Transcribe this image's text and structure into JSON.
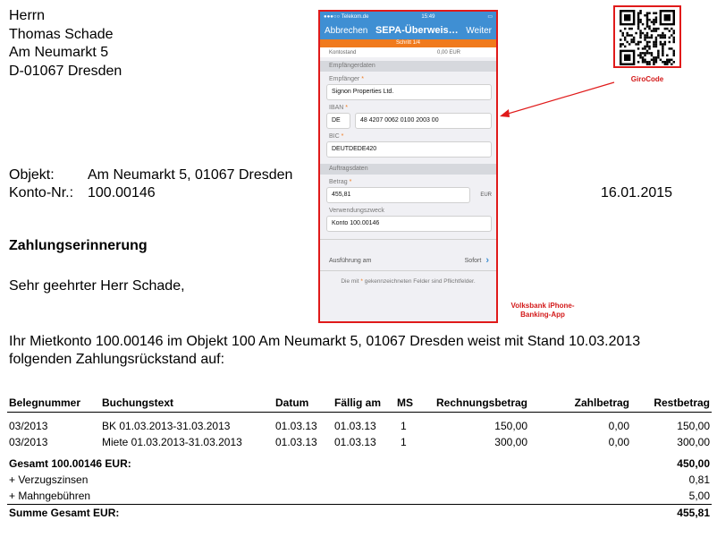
{
  "address": {
    "salutation": "Herrn",
    "name": "Thomas Schade",
    "street": "Am Neumarkt 5",
    "city": "D-01067 Dresden"
  },
  "meta": {
    "object_label": "Objekt:",
    "object_value": "Am Neumarkt 5, 01067 Dresden",
    "account_label": "Konto-Nr.:",
    "account_value": "100.00146",
    "date": "16.01.2015"
  },
  "heading": "Zahlungserinnerung",
  "greeting": "Sehr geehrter Herr Schade,",
  "paragraph": "Ihr Mietkonto 100.00146 im Objekt 100 Am Neumarkt 5, 01067 Dresden weist mit Stand 10.03.2013 folgenden Zahlungsrückstand auf:",
  "phone": {
    "carrier": "Telekom.de",
    "time": "15:49",
    "nav_back": "Abbrechen",
    "nav_title": "SEPA-Überweis…",
    "nav_next": "Weiter",
    "step": "Schritt 1/4",
    "konto_label": "Kontostand",
    "konto_value": "0,00 EUR",
    "section_recipient": "Empfängerdaten",
    "recipient_label": "Empfänger",
    "recipient_value": "Signon Properties Ltd.",
    "iban_label": "IBAN",
    "iban_country": "DE",
    "iban_value": "48 4207 0062 0100 2003 00",
    "bic_label": "BIC",
    "bic_value": "DEUTDEDE420",
    "section_order": "Auftragsdaten",
    "amount_label": "Betrag",
    "amount_value": "455,81",
    "currency": "EUR",
    "purpose_label": "Verwendungszweck",
    "purpose_value": "Konto 100.00146",
    "exec_label": "Ausführung am",
    "exec_value": "Sofort",
    "note_pre": "Die mit",
    "note_post": "gekennzeichneten Felder sind Pflichtfelder.",
    "star": "*"
  },
  "captions": {
    "app": "Volksbank iPhone-Banking-App",
    "qr": "GiroCode"
  },
  "table": {
    "headers": [
      "Belegnummer",
      "Buchungstext",
      "Datum",
      "Fällig am",
      "MS",
      "Rechnungsbetrag",
      "Zahlbetrag",
      "Restbetrag"
    ],
    "rows": [
      [
        "03/2013",
        "BK 01.03.2013-31.03.2013",
        "01.03.13",
        "01.03.13",
        "1",
        "150,00",
        "0,00",
        "150,00"
      ],
      [
        "03/2013",
        "Miete 01.03.2013-31.03.2013",
        "01.03.13",
        "01.03.13",
        "1",
        "300,00",
        "0,00",
        "300,00"
      ]
    ],
    "total_label": "Gesamt 100.00146 EUR:",
    "total_value": "450,00",
    "interest_label": "+ Verzugszinsen",
    "interest_value": "0,81",
    "fees_label": "+ Mahngebühren",
    "fees_value": "5,00",
    "sum_label": "Summe Gesamt EUR:",
    "sum_value": "455,81"
  },
  "colors": {
    "accent_red": "#e01a1a",
    "ios_blue": "#3f8fd3",
    "step_orange": "#f07a1d"
  }
}
